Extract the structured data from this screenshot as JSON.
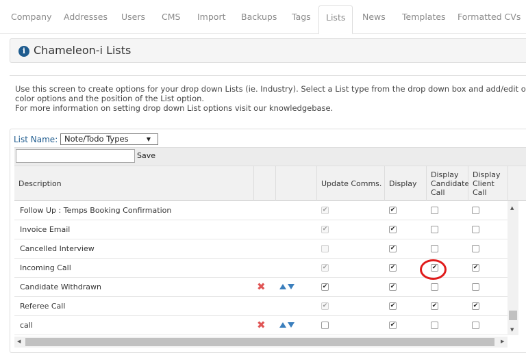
{
  "tabs": [
    {
      "label": "Company"
    },
    {
      "label": "Addresses"
    },
    {
      "label": "Users"
    },
    {
      "label": "CMS"
    },
    {
      "label": "Import"
    },
    {
      "label": "Backups"
    },
    {
      "label": "Tags"
    },
    {
      "label": "Lists",
      "active": true
    },
    {
      "label": "News"
    },
    {
      "label": "Templates"
    },
    {
      "label": "Formatted CVs"
    }
  ],
  "panel": {
    "title": "Chameleon-i Lists",
    "icon": "info-icon"
  },
  "description": {
    "line1": "Use this screen to create options for your drop down Lists (ie. Industry). Select a List type from the drop down box and add/edit or remove",
    "line2": "color options and the position of the List option.",
    "line3": "For more information on setting drop down List options visit our knowledgebase."
  },
  "list_name": {
    "label": "List Name:",
    "selected": "Note/Todo Types"
  },
  "new_item": {
    "placeholder": "",
    "save_label": "Save"
  },
  "columns": {
    "description": "Description",
    "update_comms": "Update Comms.",
    "display": "Display",
    "display_candidate_call": "Display Candidate Call",
    "display_client_call": "Display Client Call"
  },
  "rows": [
    {
      "description": "Follow Up : Temps Booking Confirmation",
      "update_comms": true,
      "update_disabled": true,
      "display": true,
      "candidate_call": false,
      "client_call": false,
      "editable": false
    },
    {
      "description": "Invoice Email",
      "update_comms": true,
      "update_disabled": true,
      "display": true,
      "candidate_call": false,
      "client_call": false,
      "editable": false
    },
    {
      "description": "Cancelled Interview",
      "update_comms": false,
      "update_disabled": true,
      "display": true,
      "candidate_call": false,
      "client_call": false,
      "editable": false
    },
    {
      "description": "Incoming Call",
      "update_comms": true,
      "update_disabled": true,
      "display": true,
      "candidate_call": true,
      "client_call": true,
      "editable": false
    },
    {
      "description": "Candidate Withdrawn",
      "update_comms": true,
      "update_disabled": false,
      "display": true,
      "candidate_call": false,
      "client_call": false,
      "editable": true
    },
    {
      "description": "Referee Call",
      "update_comms": true,
      "update_disabled": true,
      "display": true,
      "candidate_call": true,
      "client_call": true,
      "editable": false
    },
    {
      "description": "call",
      "update_comms": false,
      "update_disabled": false,
      "display": true,
      "candidate_call": false,
      "client_call": false,
      "editable": true
    }
  ],
  "colors": {
    "accent": "#1f5c8f",
    "delete": "#e05555",
    "arrow": "#3b7fbd",
    "highlight": "#e01b1b"
  }
}
